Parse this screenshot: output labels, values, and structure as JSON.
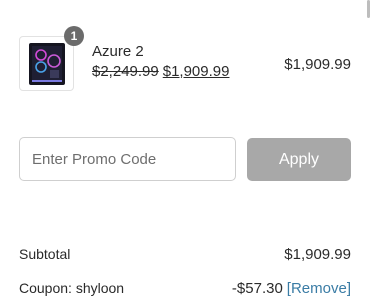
{
  "cart": {
    "item": {
      "quantity": "1",
      "name": "Azure 2",
      "original_price": "$2,249.99",
      "sale_price": "$1,909.99",
      "line_total": "$1,909.99",
      "image_icon": "pc-case-image"
    }
  },
  "promo": {
    "placeholder": "Enter Promo Code",
    "apply_label": "Apply"
  },
  "summary": {
    "subtotal_label": "Subtotal",
    "subtotal_value": "$1,909.99",
    "coupon_label": "Coupon: shyloon",
    "coupon_value": "-$57.30",
    "remove_label": "[Remove]"
  },
  "colors": {
    "apply_button_bg": "#a8a8a8",
    "badge_bg": "#6b6b6b",
    "link": "#3a7ca5"
  }
}
